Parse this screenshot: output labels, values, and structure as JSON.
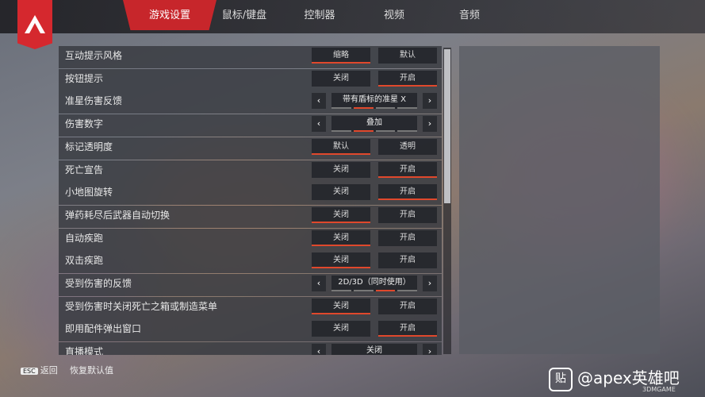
{
  "tabs": [
    {
      "label": "游戏设置",
      "active": true
    },
    {
      "label": "鼠标/键盘",
      "active": false
    },
    {
      "label": "控制器",
      "active": false
    },
    {
      "label": "视频",
      "active": false
    },
    {
      "label": "音频",
      "active": false
    }
  ],
  "settings": [
    {
      "label": "互动提示风格",
      "type": "toggle",
      "options": [
        "缩略",
        "默认"
      ],
      "selected": 0
    },
    {
      "label": "按钮提示",
      "type": "toggle",
      "options": [
        "关闭",
        "开启"
      ],
      "selected": 1
    },
    {
      "label": "准星伤害反馈",
      "type": "cycle",
      "value": "带有盾标的准星 X",
      "position": 2,
      "total": 4
    },
    {
      "label": "伤害数字",
      "type": "cycle",
      "value": "叠加",
      "position": 2,
      "total": 4
    },
    {
      "label": "标记透明度",
      "type": "toggle",
      "options": [
        "默认",
        "透明"
      ],
      "selected": 0
    },
    {
      "label": "死亡宣告",
      "type": "toggle",
      "options": [
        "关闭",
        "开启"
      ],
      "selected": 1
    },
    {
      "label": "小地图旋转",
      "type": "toggle",
      "options": [
        "关闭",
        "开启"
      ],
      "selected": 1
    },
    {
      "label": "弹药耗尽后武器自动切换",
      "type": "toggle",
      "options": [
        "关闭",
        "开启"
      ],
      "selected": 0
    },
    {
      "label": "自动疾跑",
      "type": "toggle",
      "options": [
        "关闭",
        "开启"
      ],
      "selected": 0
    },
    {
      "label": "双击疾跑",
      "type": "toggle",
      "options": [
        "关闭",
        "开启"
      ],
      "selected": 0
    },
    {
      "label": "受到伤害的反馈",
      "type": "cycle",
      "value": "2D/3D（同时使用）",
      "position": 3,
      "total": 4
    },
    {
      "label": "受到伤害时关闭死亡之箱或制造菜单",
      "type": "toggle",
      "options": [
        "关闭",
        "开启"
      ],
      "selected": 0
    },
    {
      "label": "即用配件弹出窗口",
      "type": "toggle",
      "options": [
        "关闭",
        "开启"
      ],
      "selected": 1
    },
    {
      "label": "直播模式",
      "type": "cycle",
      "value": "关闭",
      "position": 1,
      "total": 4
    }
  ],
  "footer": {
    "esc_key": "ESC",
    "back_label": "返回",
    "reset_label": "恢复默认值"
  },
  "watermark": {
    "text": "@apex英雄吧",
    "sub": "3DMGAME"
  },
  "colors": {
    "accent": "#e0482c",
    "tab_active": "#c7262b",
    "logo": "#d5282e"
  }
}
